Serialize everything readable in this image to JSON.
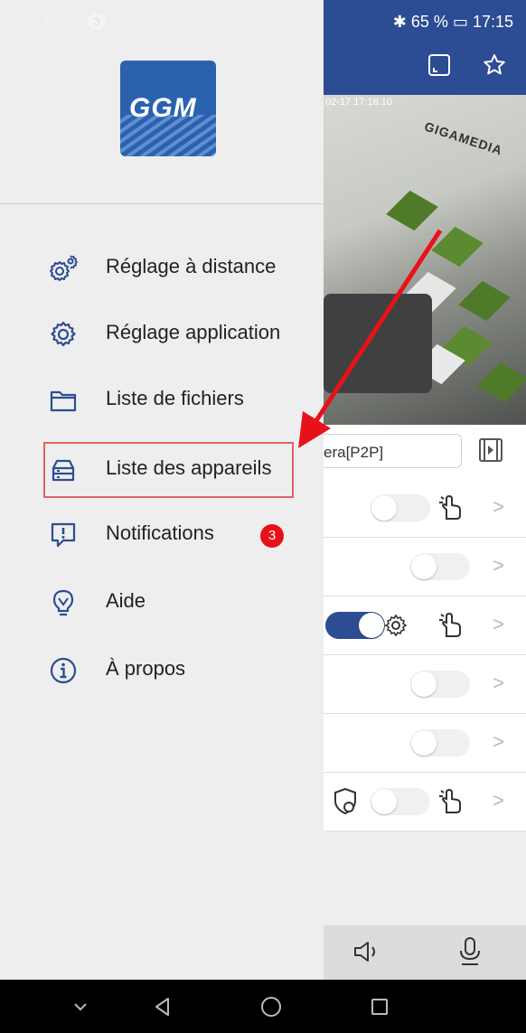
{
  "status_bar": {
    "network": "4G",
    "speed": "145K/s",
    "notif_count": "3",
    "battery": "65 %",
    "time": "17:15"
  },
  "video": {
    "timestamp": "02-17 17:16:10",
    "wall_text": "GIGAMEDIA"
  },
  "camera": {
    "name_partial": "era[P2P]"
  },
  "drawer": {
    "logo_text": "GGM",
    "items": [
      {
        "label": "Réglage à distance",
        "icon": "gears-icon"
      },
      {
        "label": "Réglage application",
        "icon": "gear-icon"
      },
      {
        "label": "Liste de fichiers",
        "icon": "folder-icon"
      },
      {
        "label": "Liste des appareils",
        "icon": "device-list-icon"
      },
      {
        "label": "Notifications",
        "icon": "alert-icon",
        "badge": "3"
      },
      {
        "label": "Aide",
        "icon": "bulb-icon"
      },
      {
        "label": "À propos",
        "icon": "info-icon"
      }
    ]
  },
  "colors": {
    "accent": "#2c4c93",
    "badge": "#e8111a",
    "highlight": "#e06264",
    "arrow": "#e8111a"
  }
}
